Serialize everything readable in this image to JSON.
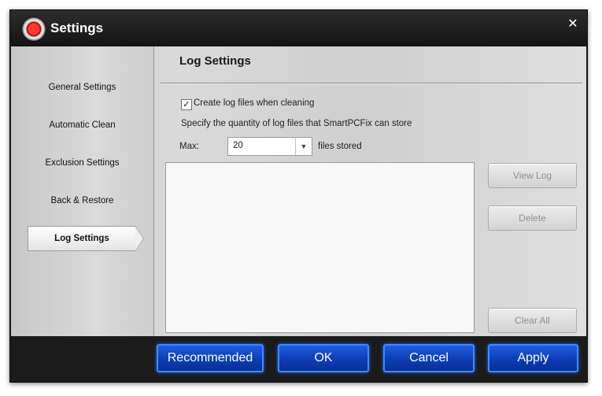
{
  "window": {
    "title": "Settings",
    "close_label": "✕"
  },
  "sidebar": {
    "items": [
      {
        "label": "General Settings"
      },
      {
        "label": "Automatic Clean"
      },
      {
        "label": "Exclusion Settings"
      },
      {
        "label": "Back & Restore"
      },
      {
        "label": "Log Settings",
        "active": true
      }
    ]
  },
  "content": {
    "title": "Log Settings",
    "create_logs": {
      "label": "Create log files when cleaning",
      "checked": true,
      "check_glyph": "✓"
    },
    "description": "Specify the quantity of log files that SmartPCFix can store",
    "max_label": "Max:",
    "max_value": "20",
    "max_arrow": "▼",
    "files_suffix": "files stored",
    "buttons": {
      "view_log": "View Log",
      "delete": "Delete",
      "clear_all": "Clear All"
    }
  },
  "footer": {
    "recommended": "Recommended",
    "ok": "OK",
    "cancel": "Cancel",
    "apply": "Apply"
  },
  "colors": {
    "accent": "#0e3fb8",
    "accent_border": "#3a8cff",
    "titlebar": "#1d1d1d",
    "panel": "#d4d4d4"
  }
}
